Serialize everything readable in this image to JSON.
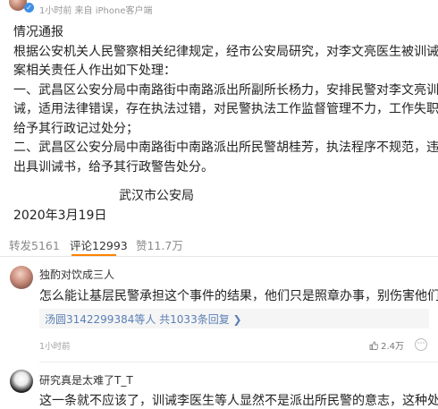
{
  "post_meta": {
    "time_source": "1小时前  来自 iPhone客户端"
  },
  "post": {
    "lines": [
      "情况通报",
      "根据公安机关人民警察相关纪律规定，经市公安局研究，对李文亮医生被训诫一",
      "案相关责任人作出如下处理：",
      "一、武昌区公安分局中南路街中南路派出所副所长杨力，安排民警对李文亮训",
      "诫，适用法律错误，存在执法过错，对民警执法工作监督管理不力，工作失职，",
      "给予其行政记过处分；",
      "二、武昌区公安分局中南路街中南路派出所民警胡桂芳，执法程序不规范，违规",
      "出具训诫书，给予其行政警告处分。"
    ],
    "signature": "武汉市公安局",
    "date": "2020年3月19日"
  },
  "actions": {
    "repost": "转发5161",
    "comment": "评论12993",
    "like": "赞11.7万"
  },
  "comments": [
    {
      "name": "独酌对饮成三人",
      "text": "怎么能让基层民警承担这个事件的结果，他们只是照章办事，别伤害他们！",
      "reply_summary": "汤圆3142299384等人 共1033条回复",
      "time": "1小时前",
      "likes": "2.4万"
    },
    {
      "name": "研究真是太难了T_T",
      "text": "这一条就不应该了，训诫李医生等人显然不是派出所民警的意志，这种处罚"
    }
  ],
  "icons": {
    "verify": "verified-badge-icon",
    "like": "thumb-up-icon",
    "more": "more-options-icon",
    "chevron": "chevron-right-icon"
  },
  "colors": {
    "accent": "#ff8200",
    "link": "#5b7fb5",
    "verify": "#3f8fe6"
  }
}
